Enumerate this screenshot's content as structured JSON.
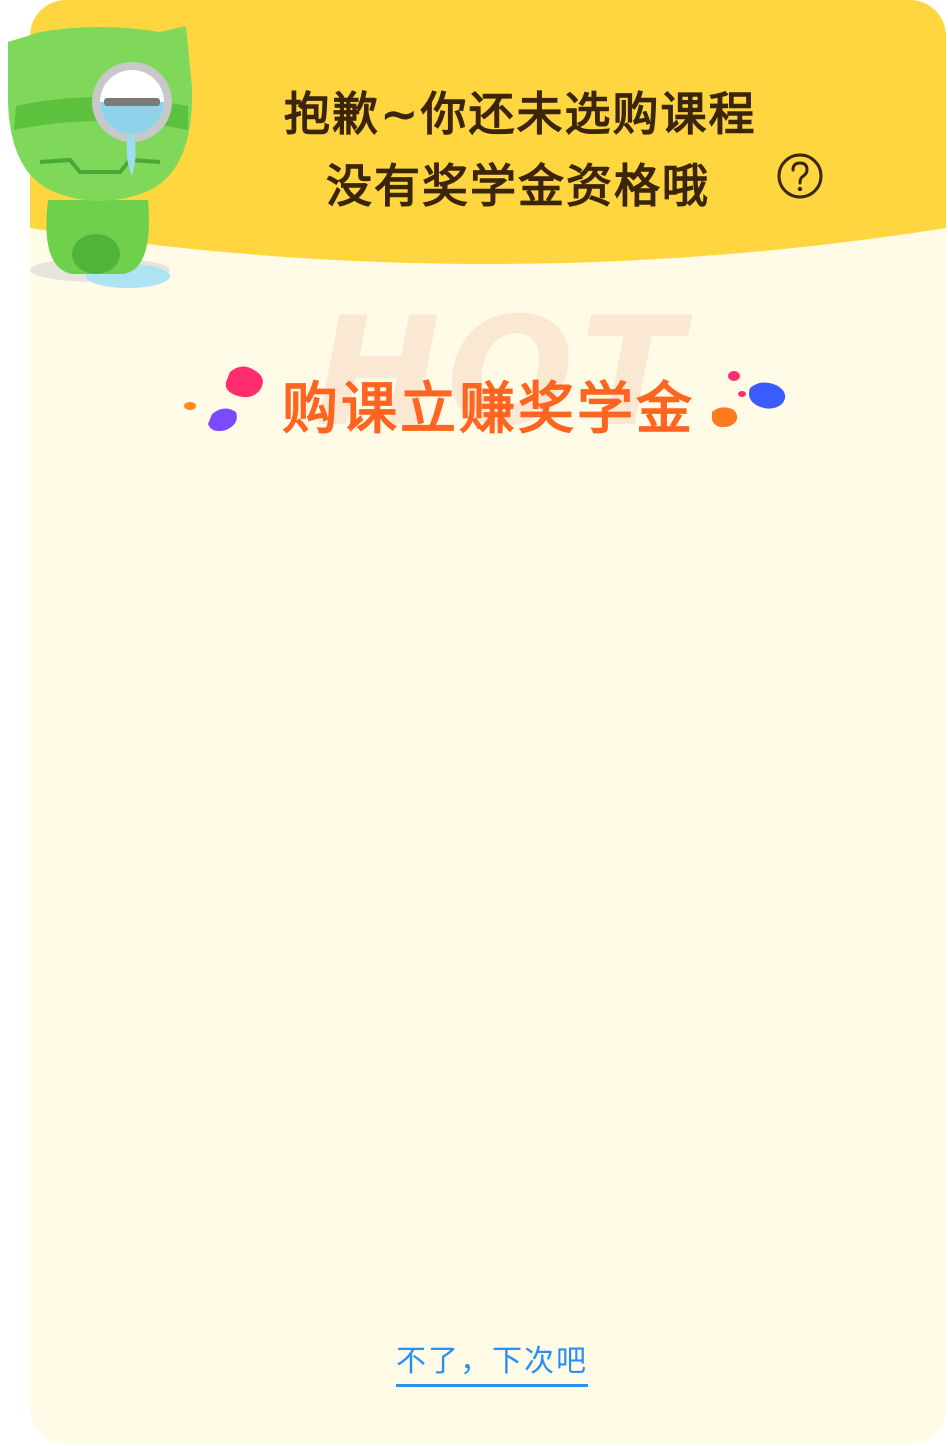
{
  "header": {
    "title_line1": "抱歉~你还未选购课程",
    "title_line2": "没有奖学金资格哦",
    "help_icon": "question-circle-icon"
  },
  "promo": {
    "watermark": "HOT",
    "title": "购课立赚奖学金"
  },
  "footer": {
    "skip_label": "不了，下次吧"
  },
  "colors": {
    "header": "#ffd640",
    "background": "#fffbe6",
    "promo_title": "#ff6420",
    "link": "#2a8ef2",
    "title_text": "#3b2508"
  }
}
